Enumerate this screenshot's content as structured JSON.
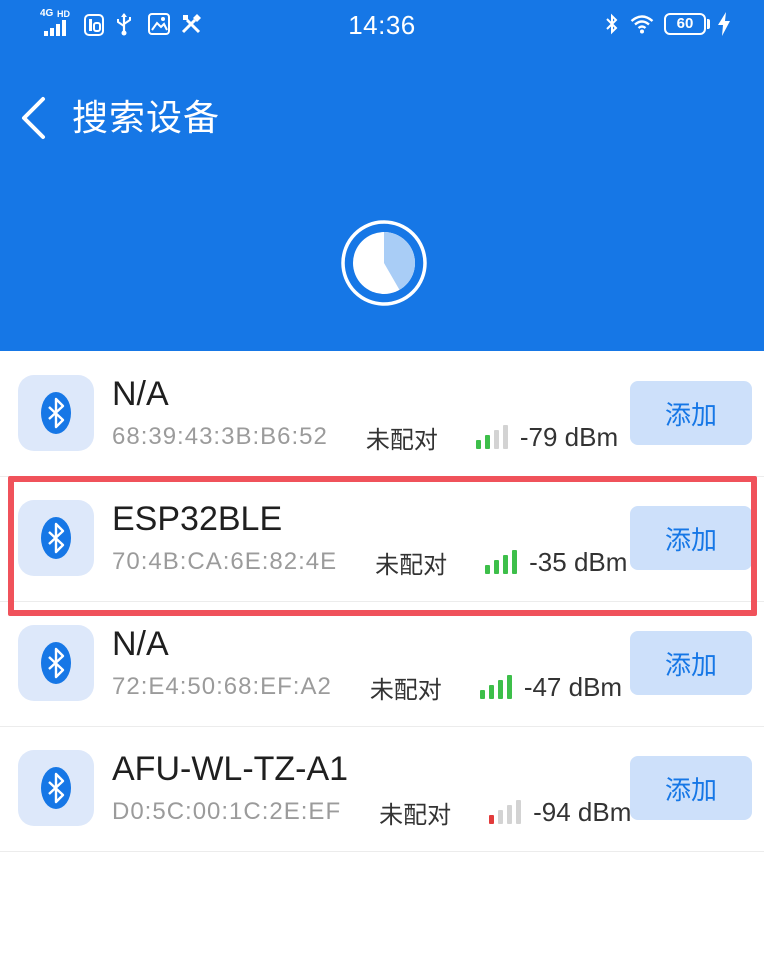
{
  "status_bar": {
    "time": "14:36",
    "network_type": "4G",
    "network_badge": "HD",
    "battery_level": "60",
    "left_icons": [
      "cellular-signal-icon",
      "app-notification-icon",
      "usb-icon",
      "gallery-icon",
      "tools-icon"
    ],
    "right_icons": [
      "bluetooth-status-icon",
      "wifi-icon",
      "battery-icon",
      "charging-icon"
    ]
  },
  "header": {
    "title": "搜索设备",
    "back_icon": "chevron-left-icon",
    "scan_indicator_icon": "scanning-spinner-icon"
  },
  "device_icon": "bluetooth-icon",
  "devices": [
    {
      "name": "N/A",
      "mac": "68:39:43:3B:B6:52",
      "status": "未配对",
      "rssi": "-79 dBm",
      "signal_level": 2,
      "signal_color": "#3dbf4a",
      "action": "添加",
      "highlighted": false
    },
    {
      "name": "ESP32BLE",
      "mac": "70:4B:CA:6E:82:4E",
      "status": "未配对",
      "rssi": "-35 dBm",
      "signal_level": 4,
      "signal_color": "#3dbf4a",
      "action": "添加",
      "highlighted": true
    },
    {
      "name": "N/A",
      "mac": "72:E4:50:68:EF:A2",
      "status": "未配对",
      "rssi": "-47 dBm",
      "signal_level": 4,
      "signal_color": "#3dbf4a",
      "action": "添加",
      "highlighted": false
    },
    {
      "name": "AFU-WL-TZ-A1",
      "mac": "D0:5C:00:1C:2E:EF",
      "status": "未配对",
      "rssi": "-94 dBm",
      "signal_level": 1,
      "signal_color": "#e23b3b",
      "action": "添加",
      "highlighted": false
    }
  ],
  "colors": {
    "primary": "#1677e6",
    "button_bg": "#cde0fa",
    "icon_bg": "#dde8fa",
    "highlight": "#f0525b",
    "signal_off": "#d3d3d3"
  }
}
